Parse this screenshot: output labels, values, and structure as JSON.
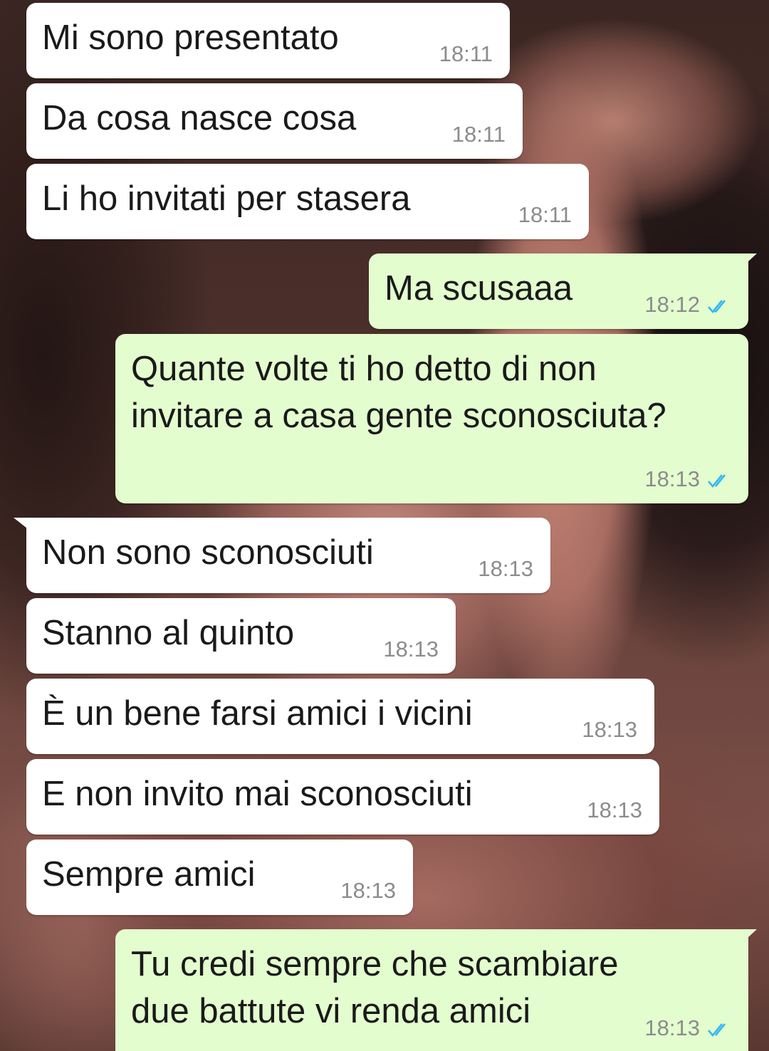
{
  "messages": [
    {
      "text": "Mi sono presentato",
      "time": "18:11"
    },
    {
      "text": "Da cosa nasce cosa",
      "time": "18:11"
    },
    {
      "text": "Li ho invitati per stasera",
      "time": "18:11"
    },
    {
      "text": "Ma scusaaa",
      "time": "18:12",
      "status": "read"
    },
    {
      "line1": "Quante volte ti ho detto di non",
      "line2": "invitare a casa gente sconosciuta?",
      "time": "18:13",
      "status": "read"
    },
    {
      "text": "Non sono sconosciuti",
      "time": "18:13"
    },
    {
      "text": "Stanno al quinto",
      "time": "18:13"
    },
    {
      "text": "È un bene farsi amici i vicini",
      "time": "18:13"
    },
    {
      "text": "E non invito mai sconosciuti",
      "time": "18:13"
    },
    {
      "text": "Sempre amici",
      "time": "18:13"
    },
    {
      "line1": "Tu credi sempre che scambiare",
      "line2": "due battute vi renda amici",
      "time": "18:13",
      "status": "read"
    }
  ],
  "colors": {
    "incoming_bubble": "#ffffff",
    "outgoing_bubble": "#e3fdcf",
    "read_ticks": "#34b7f1",
    "timestamp": "#8c8c8c"
  },
  "icons": {
    "read_status": "double-check-icon"
  }
}
